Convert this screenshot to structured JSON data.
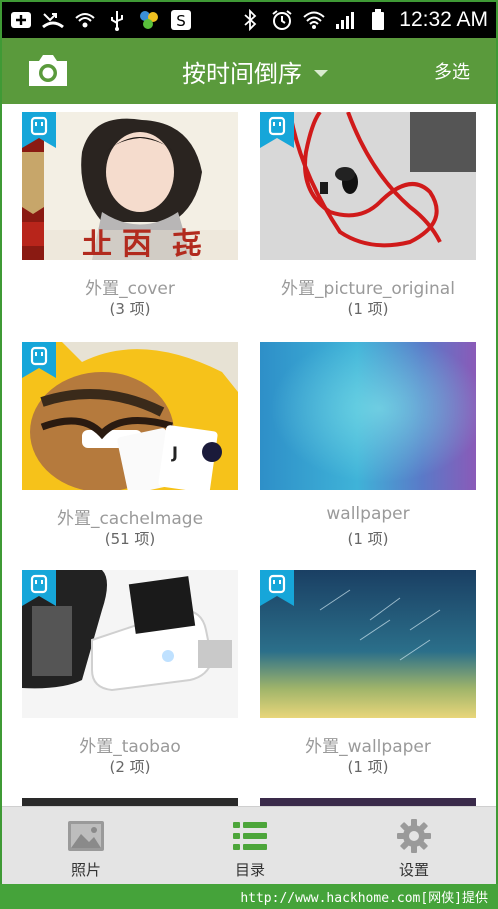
{
  "status_bar": {
    "time": "12:32 AM",
    "left_icons": [
      "keyboard-icon",
      "missed-call-icon",
      "wifi-hotspot-icon",
      "usb-icon",
      "app-icon",
      "screenshot-app-icon"
    ],
    "right_icons": [
      "bluetooth-icon",
      "alarm-icon",
      "wifi-icon",
      "signal-icon",
      "battery-icon"
    ]
  },
  "action_bar": {
    "title": "按时间倒序",
    "multi_select_label": "多选",
    "color": "#5a9a3c"
  },
  "albums": [
    {
      "name": "外置_cover",
      "count": "(3 项)"
    },
    {
      "name": "外置_picture_original",
      "count": "(1 项)"
    },
    {
      "name": "外置_cacheImage",
      "count": "(51 项)"
    },
    {
      "name": "wallpaper",
      "count": "(1 项)"
    },
    {
      "name": "外置_taobao",
      "count": "(2 项)"
    },
    {
      "name": "外置_wallpaper",
      "count": "(1 项)"
    }
  ],
  "bottom_nav": {
    "photos_label": "照片",
    "catalog_label": "目录",
    "settings_label": "设置"
  },
  "footer": {
    "text": "http://www.hackhome.com[网侠]提供"
  }
}
